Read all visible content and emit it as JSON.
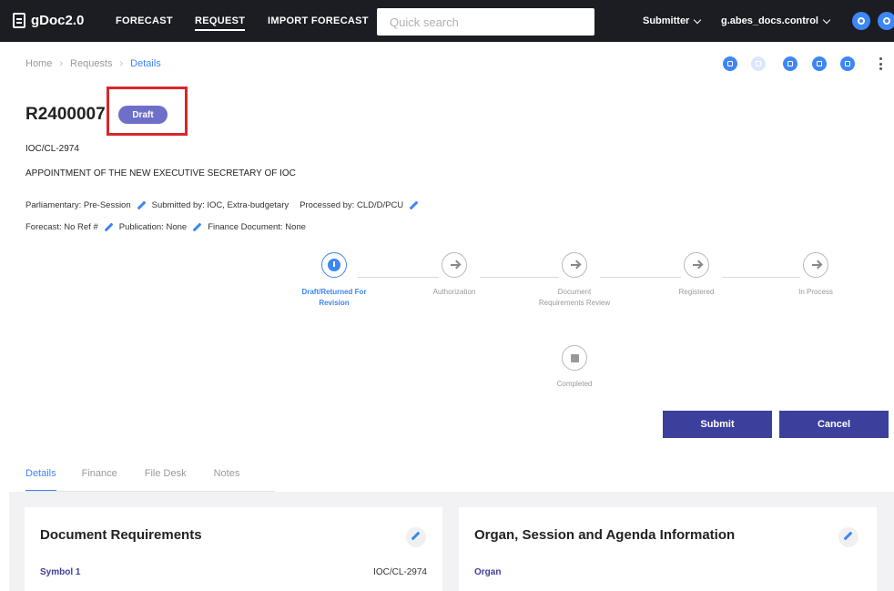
{
  "topbar": {
    "brand": "gDoc2.0",
    "nav": [
      "FORECAST",
      "REQUEST",
      "IMPORT FORECAST"
    ],
    "search_placeholder": "Quick search",
    "role": "Submitter",
    "user": "g.abes_docs.control"
  },
  "breadcrumb": [
    "Home",
    "Requests",
    "Details"
  ],
  "request": {
    "id": "R2400007",
    "status": "Draft",
    "symbol": "IOC/CL-2974",
    "title": "APPOINTMENT OF THE NEW EXECUTIVE SECRETARY OF IOC",
    "parliamentary_label": "Parliamentary: Pre-Session",
    "submitted_label": "Submitted by: IOC, Extra-budgetary",
    "processed_label": "Processed by: CLD/D/PCU",
    "forecast_label": "Forecast: No Ref #",
    "publication_label": "Publication: None",
    "finance_label": "Finance Document: None"
  },
  "steps": [
    {
      "line1": "Draft/Returned For",
      "line2": "Revision",
      "state": "active"
    },
    {
      "line1": "Authorization",
      "line2": "",
      "state": "pending"
    },
    {
      "line1": "Document",
      "line2": "Requirements Review",
      "state": "pending"
    },
    {
      "line1": "Registered",
      "line2": "",
      "state": "pending"
    },
    {
      "line1": "In Process",
      "line2": "",
      "state": "pending"
    },
    {
      "line1": "Completed",
      "line2": "",
      "state": "pending"
    }
  ],
  "buttons": {
    "submit": "Submit",
    "cancel": "Cancel"
  },
  "tabs": [
    "Details",
    "Finance",
    "File Desk",
    "Notes"
  ],
  "cards": {
    "doc_req": {
      "title": "Document Requirements",
      "label": "Symbol 1",
      "value": "IOC/CL-2974"
    },
    "organ": {
      "title": "Organ, Session and Agenda Information",
      "label": "Organ"
    }
  },
  "colors": {
    "accent": "#3d86f5",
    "primary_button": "#3c3f9b",
    "badge": "#6e6fc8",
    "highlight": "#d9262b"
  }
}
